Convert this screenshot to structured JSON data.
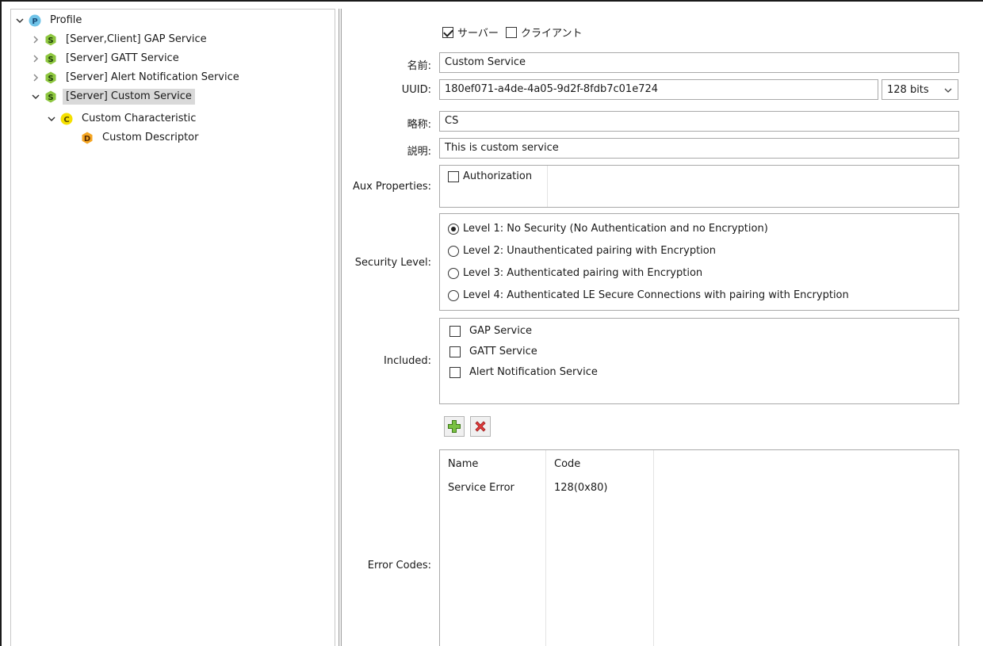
{
  "tree": {
    "root": {
      "label": "Profile",
      "icon": "profile-icon",
      "badge": "P"
    },
    "services": [
      {
        "label": "[Server,Client] GAP Service",
        "badge": "S",
        "expanded": false
      },
      {
        "label": "[Server] GATT Service",
        "badge": "S",
        "expanded": false
      },
      {
        "label": "[Server] Alert Notification Service",
        "badge": "S",
        "expanded": false
      },
      {
        "label": "[Server] Custom Service",
        "badge": "S",
        "expanded": true,
        "selected": true
      }
    ],
    "characteristic": {
      "label": "Custom Characteristic",
      "badge": "C"
    },
    "descriptor": {
      "label": "Custom Descriptor",
      "badge": "D"
    }
  },
  "form": {
    "role": {
      "server_label": "サーバー",
      "server_checked": true,
      "client_label": "クライアント",
      "client_checked": false
    },
    "name": {
      "label": "名前:",
      "value": "Custom Service"
    },
    "uuid": {
      "label": "UUID:",
      "value": "180ef071-a4de-4a05-9d2f-8fdb7c01e724",
      "bits": "128 bits"
    },
    "short_name": {
      "label": "略称:",
      "value": "CS"
    },
    "description": {
      "label": "説明:",
      "value": "This is custom service"
    },
    "aux": {
      "label": "Aux Properties:",
      "authorization_label": "Authorization",
      "authorization_checked": false
    },
    "security": {
      "label": "Security Level:",
      "options": [
        "Level 1: No Security (No Authentication and no Encryption)",
        "Level 2: Unauthenticated pairing with Encryption",
        "Level 3: Authenticated pairing with Encryption",
        "Level 4: Authenticated LE Secure Connections with pairing with Encryption"
      ],
      "selected_index": 0
    },
    "included": {
      "label": "Included:",
      "items": [
        "GAP Service",
        "GATT Service",
        "Alert Notification Service"
      ]
    },
    "error_codes": {
      "label": "Error Codes:",
      "columns": [
        "Name",
        "Code"
      ],
      "rows": [
        {
          "name": "Service Error",
          "code": "128(0x80)"
        }
      ]
    }
  },
  "colors": {
    "service_badge": "#8dc63f",
    "char_badge": "#f5e000",
    "desc_badge": "#f5a623",
    "profile_badge": "#6fc3e8"
  }
}
